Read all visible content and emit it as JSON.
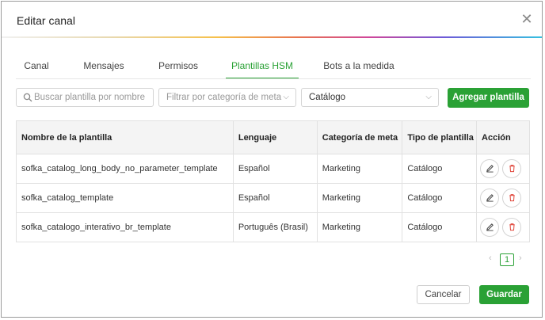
{
  "dialog": {
    "title": "Editar canal"
  },
  "tabs": [
    {
      "label": "Canal"
    },
    {
      "label": "Mensajes"
    },
    {
      "label": "Permisos"
    },
    {
      "label": "Plantillas HSM"
    },
    {
      "label": "Bots a la medida"
    }
  ],
  "toolbar": {
    "search_placeholder": "Buscar plantilla por nombre",
    "meta_filter_placeholder": "Filtrar por categoría de meta",
    "type_filter_value": "Catálogo",
    "add_label": "Agregar plantilla"
  },
  "table": {
    "headers": [
      "Nombre de la plantilla",
      "Lenguaje",
      "Categoría de meta",
      "Tipo de plantilla",
      "Acción"
    ],
    "rows": [
      [
        "sofka_catalog_long_body_no_parameter_template",
        "Español",
        "Marketing",
        "Catálogo"
      ],
      [
        "sofka_catalog_template",
        "Español",
        "Marketing",
        "Catálogo"
      ],
      [
        "sofka_catalogo_interativo_br_template",
        "Português (Brasil)",
        "Marketing",
        "Catálogo"
      ]
    ]
  },
  "pagination": {
    "prev": "‹",
    "current": "1",
    "next": "›"
  },
  "footer": {
    "cancel_label": "Cancelar",
    "save_label": "Guardar"
  },
  "colors": {
    "accent": "#2aa135",
    "delete": "#e0453a"
  }
}
